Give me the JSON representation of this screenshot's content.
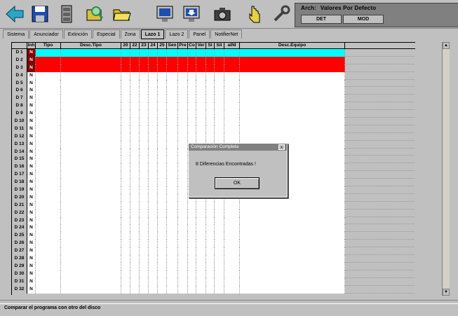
{
  "toolbar": {
    "buttons": [
      {
        "icon": "back-arrow-icon",
        "color": "#2aa6c8"
      },
      {
        "icon": "save-icon",
        "color": "#1c4fae"
      },
      {
        "icon": "cabinet-icon",
        "color": "#808080"
      },
      {
        "icon": "folder-search-icon",
        "color": "#2e8b57"
      },
      {
        "icon": "open-folder-icon",
        "color": "#c8b000"
      },
      {
        "icon": "monitor-icon",
        "color": "#1c4fae"
      },
      {
        "icon": "download-icon",
        "color": "#1c4fae"
      },
      {
        "icon": "camera-icon",
        "color": "#404040"
      },
      {
        "icon": "pointer-icon",
        "color": "#c8b000"
      },
      {
        "icon": "tools-icon",
        "color": "#404040"
      }
    ],
    "arch_label": "Arch:",
    "arch_value": "Valores Por Defecto",
    "box1": "DET",
    "box2": "MOD"
  },
  "tabs": [
    "Sistema",
    "Anunciador",
    "Extinción",
    "Especial",
    "Zona",
    "Lazo 1",
    "Lazo 2",
    "Panel",
    "NotifierNet"
  ],
  "active_tab": "Lazo 1",
  "grid": {
    "headers": [
      "",
      "Inh",
      "Tipo",
      "Desc.Tipo",
      "20",
      "22",
      "23",
      "24",
      "25",
      "Sen",
      "Pre",
      "Co",
      "Ver",
      "Sl",
      "Sil",
      "aINI",
      "Desc.Equipo"
    ],
    "row_labels": [
      "D 1",
      "D 2",
      "D 3",
      "D 4",
      "D 5",
      "D 6",
      "D 7",
      "D 8",
      "D 9",
      "D 10",
      "D 11",
      "D 12",
      "D 13",
      "D 14",
      "D 15",
      "D 16",
      "D 17",
      "D 18",
      "D 19",
      "D 20",
      "D 21",
      "D 22",
      "D 23",
      "D 24",
      "D 25",
      "D 26",
      "D 27",
      "D 28",
      "D 29",
      "D 30",
      "D 31",
      "D 32"
    ],
    "inh_value": "N",
    "highlight": {
      "cyan_rows": [
        0
      ],
      "red_rows": [
        1,
        2
      ]
    }
  },
  "colors": {
    "cyan": "#00ffff",
    "red": "#ff0000"
  },
  "dialog": {
    "title": "Comparación Completa",
    "message": "8 Diferencias Encontradas !",
    "ok_label": "OK",
    "close_label": "x"
  },
  "status": {
    "text": "Comparar el programa con otro del disco"
  }
}
